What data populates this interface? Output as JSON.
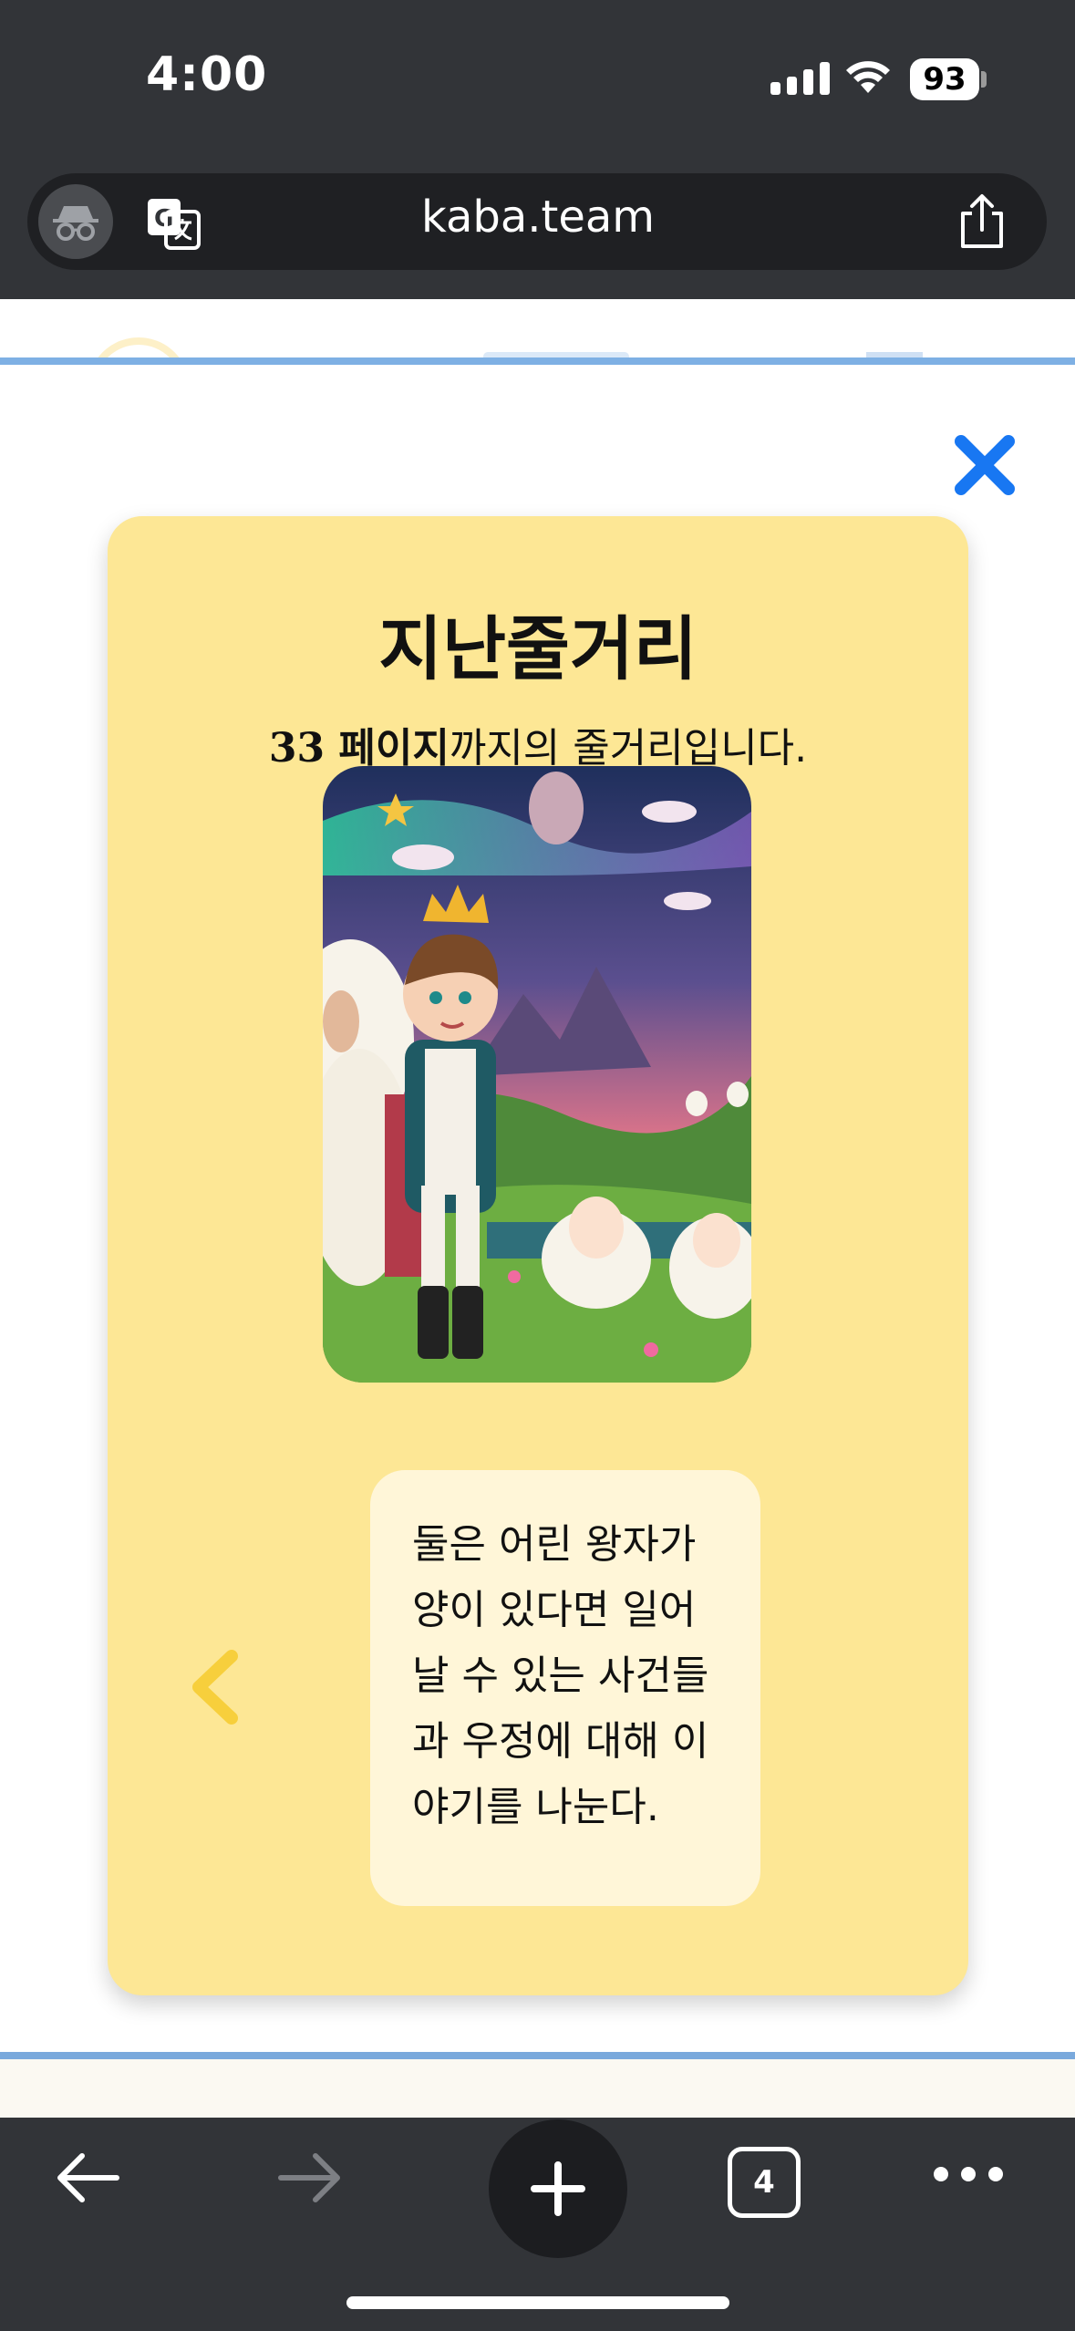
{
  "status_bar": {
    "time": "4:00",
    "battery": "93"
  },
  "browser": {
    "url": "kaba.team",
    "tab_count": "4"
  },
  "modal": {
    "title": "지난줄거리",
    "subtitle_bold": "33 페이지",
    "subtitle_rest": "까지의 줄거리입니다.",
    "summary": "둘은 어린 왕자가 양이 있다면 일어날 수 있는 사건들과 우정에 대해 이야기를 나눈다.",
    "illustration_icon": "prince-with-sheep-illustration"
  },
  "icons": {
    "close": "close-icon",
    "prev": "chevron-left-icon",
    "incognito": "incognito-icon",
    "translate": "translate-icon",
    "share": "share-icon",
    "back": "back-arrow-icon",
    "forward": "forward-arrow-icon",
    "new_tab": "plus-icon",
    "more": "more-dots-icon"
  },
  "colors": {
    "card": "#fde795",
    "summary_box": "#fff6d8",
    "close": "#1877f2",
    "chevron": "#f7cf3c",
    "chrome": "#323438"
  }
}
